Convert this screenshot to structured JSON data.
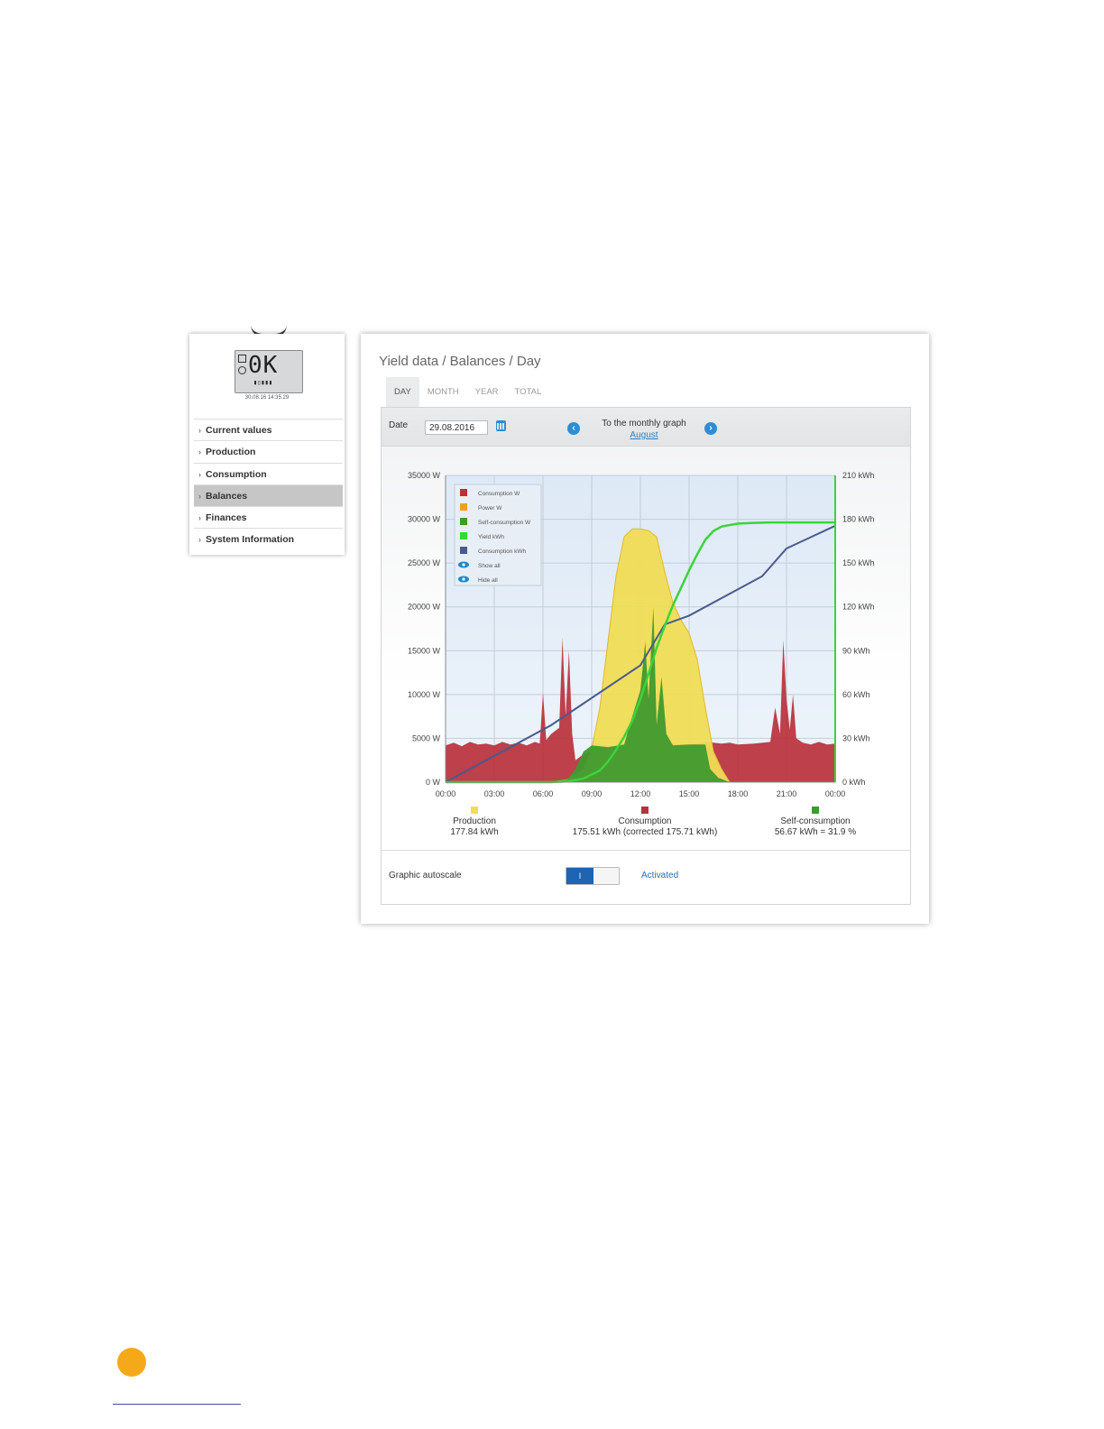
{
  "sidebar": {
    "device_display": "0K",
    "device_time": "30.08.16 14:35:29",
    "items": [
      {
        "label": "Current values",
        "active": false
      },
      {
        "label": "Production",
        "active": false
      },
      {
        "label": "Consumption",
        "active": false
      },
      {
        "label": "Balances",
        "active": true
      },
      {
        "label": "Finances",
        "active": false
      },
      {
        "label": "System Information",
        "active": false
      }
    ]
  },
  "main": {
    "breadcrumb": "Yield data / Balances / Day",
    "tabs": [
      {
        "label": "DAY",
        "active": true
      },
      {
        "label": "MONTH",
        "active": false
      },
      {
        "label": "YEAR",
        "active": false
      },
      {
        "label": "TOTAL",
        "active": false
      }
    ],
    "date_label": "Date",
    "date_value": "29.08.2016",
    "monthly_graph_text": "To the monthly graph",
    "monthly_graph_link": "August",
    "autoscale_label": "Graphic autoscale",
    "autoscale_toggle": "I",
    "autoscale_status": "Activated"
  },
  "colors": {
    "production": "#f0dc55",
    "consumption": "#b8313b",
    "self_consumption": "#3f9a2f",
    "yield": "#3ad43a",
    "consumption_kwh": "#4a5a8c",
    "power": "#f0a020"
  },
  "chart_data": {
    "type": "area",
    "x_ticks": [
      "00:00",
      "03:00",
      "06:00",
      "09:00",
      "12:00",
      "15:00",
      "18:00",
      "21:00",
      "00:00"
    ],
    "y_left_ticks": [
      "0 W",
      "5000 W",
      "10000 W",
      "15000 W",
      "20000 W",
      "25000 W",
      "30000 W",
      "35000 W"
    ],
    "y_right_ticks": [
      "0 kWh",
      "30 kWh",
      "60 kWh",
      "90 kWh",
      "120 kWh",
      "150 kWh",
      "180 kWh",
      "210 kWh"
    ],
    "ylim_left": [
      0,
      35000
    ],
    "ylim_right": [
      0,
      210
    ],
    "xlim": [
      0,
      24
    ],
    "grid": true,
    "legend_position": "top-left",
    "legend": [
      "Consumption W",
      "Power W",
      "Self-consumption W",
      "Yield kWh",
      "Consumption kWh",
      "Show all",
      "Hide all"
    ],
    "series": [
      {
        "name": "Power W",
        "axis": "left",
        "x": [
          6.5,
          7.5,
          8.5,
          9.0,
          9.5,
          10.0,
          10.5,
          11.0,
          11.5,
          12.0,
          12.5,
          13.0,
          13.5,
          14.0,
          14.5,
          15.0,
          15.5,
          16.0,
          16.5,
          17.0,
          17.5
        ],
        "y": [
          0,
          300,
          1500,
          3800,
          8500,
          16000,
          23500,
          28000,
          28900,
          28900,
          28700,
          28000,
          24000,
          20500,
          18500,
          17000,
          14000,
          8500,
          3500,
          1500,
          0
        ]
      },
      {
        "name": "Consumption W",
        "axis": "left",
        "x": [
          0,
          0.5,
          1,
          1.5,
          2,
          2.5,
          3,
          3.5,
          4,
          4.5,
          5,
          5.5,
          5.8,
          6.0,
          6.2,
          6.5,
          7.0,
          7.2,
          7.4,
          7.6,
          7.8,
          8.0,
          8.5,
          9.0,
          10.0,
          11.0,
          12.0,
          12.3,
          12.5,
          12.8,
          13.0,
          13.5,
          14.0,
          14.5,
          15.0,
          15.5,
          16.0,
          16.5,
          17.0,
          17.5,
          18.0,
          19.0,
          20.0,
          20.3,
          20.6,
          20.8,
          21.0,
          21.2,
          21.4,
          21.6,
          22.0,
          22.5,
          23.0,
          23.5,
          24.0
        ],
        "y": [
          4200,
          4500,
          4100,
          4600,
          4300,
          4400,
          4200,
          4600,
          4300,
          4500,
          4200,
          4600,
          4400,
          10200,
          4800,
          5500,
          6200,
          16500,
          7500,
          15000,
          5500,
          2500,
          3200,
          3500,
          3800,
          4000,
          4200,
          16500,
          8000,
          20000,
          5000,
          4300,
          4400,
          4200,
          4300,
          4400,
          4600,
          4500,
          4400,
          4500,
          4300,
          4400,
          4600,
          8500,
          5500,
          16200,
          9500,
          6000,
          10000,
          5000,
          4500,
          4300,
          4600,
          4300,
          4400
        ]
      },
      {
        "name": "Self-consumption W",
        "axis": "left",
        "x": [
          6.5,
          7.5,
          8.0,
          8.5,
          9.0,
          10.0,
          11.0,
          11.5,
          12.0,
          12.3,
          12.5,
          12.8,
          13.0,
          13.3,
          13.6,
          14.0,
          15.0,
          16.0,
          16.3,
          16.8,
          17.5
        ],
        "y": [
          0,
          300,
          1500,
          3500,
          4200,
          4000,
          4300,
          7500,
          10500,
          16000,
          9500,
          20000,
          6500,
          12000,
          5500,
          4200,
          4300,
          4300,
          1500,
          500,
          0
        ]
      },
      {
        "name": "Yield kWh",
        "axis": "right",
        "x": [
          0,
          6.5,
          7.5,
          8.5,
          9.5,
          10.0,
          10.5,
          11.0,
          11.5,
          12.0,
          12.5,
          13.0,
          13.5,
          14.0,
          14.5,
          15.0,
          15.5,
          16.0,
          16.5,
          17.0,
          18.0,
          19.0,
          20.0,
          21.0,
          22.0,
          24.0
        ],
        "y": [
          0,
          0,
          0.5,
          2.5,
          8,
          14,
          22,
          31,
          42,
          57,
          74,
          92,
          107,
          121,
          133,
          145,
          156,
          166,
          172,
          175,
          177,
          177.5,
          177.8,
          177.84,
          177.84,
          177.84
        ]
      },
      {
        "name": "Consumption kWh",
        "axis": "right",
        "x": [
          0,
          6.5,
          12,
          13.5,
          15,
          19.5,
          21,
          24
        ],
        "y": [
          0,
          39,
          80,
          108,
          114,
          141,
          160,
          175.51
        ]
      }
    ],
    "totals": [
      {
        "label": "Production",
        "value": "177.84 kWh"
      },
      {
        "label": "Consumption",
        "value": "175.51 kWh (corrected 175.71 kWh)"
      },
      {
        "label": "Self-consumption",
        "value": "56.67 kWh = 31.9 %"
      }
    ]
  }
}
